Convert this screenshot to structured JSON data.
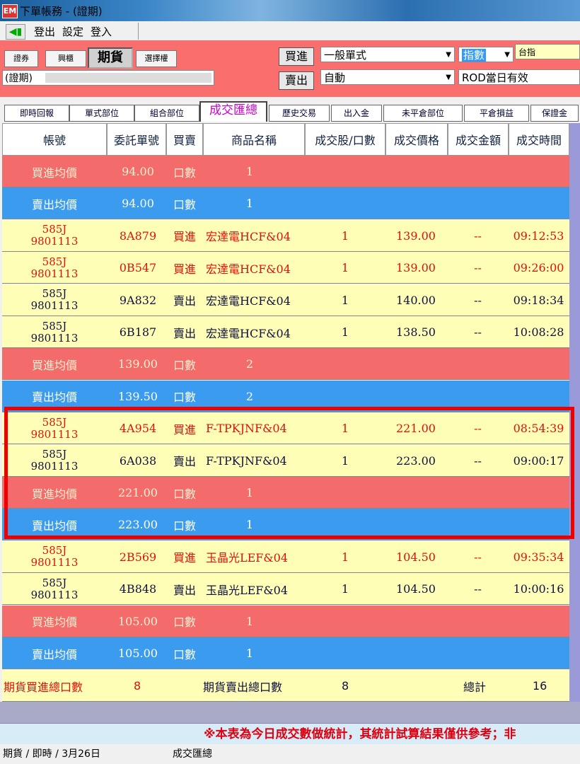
{
  "window": {
    "title": "下單帳務 - (證期)",
    "app_badge": "EM"
  },
  "menu": {
    "items": [
      "登出",
      "設定",
      "登入"
    ]
  },
  "toolbar": {
    "market_buttons": [
      "證券",
      "興櫃",
      "期貨",
      "選擇權"
    ],
    "account": "(證期)",
    "buy_label": "買進",
    "sell_label": "賣出",
    "order_type": "一般單式",
    "auto": "自動",
    "index_type": "指數",
    "index_name": "台指",
    "validity": "ROD當日有效"
  },
  "tabs": [
    "即時回報",
    "單式部位",
    "組合部位",
    "成交匯總",
    "歷史交易",
    "出入金",
    "未平倉部位",
    "平倉損益",
    "保證金"
  ],
  "columns": [
    "帳號",
    "委託單號",
    "買賣",
    "商品名稱",
    "成交股/口數",
    "成交價格",
    "成交金額",
    "成交時間"
  ],
  "rows": [
    {
      "kind": "buy-avg",
      "label": "買進均價",
      "price": "94.00",
      "unit": "口數",
      "count": "1"
    },
    {
      "kind": "sell-avg",
      "label": "賣出均價",
      "price": "94.00",
      "unit": "口數",
      "count": "1"
    },
    {
      "kind": "trade",
      "color": "red",
      "acct1": "585J",
      "acct2": "9801113",
      "order": "8A879",
      "side": "買進",
      "product": "宏達電HCF&04",
      "qty": "1",
      "price": "139.00",
      "amount": "--",
      "time": "09:12:53"
    },
    {
      "kind": "trade",
      "color": "red",
      "acct1": "585J",
      "acct2": "9801113",
      "order": "0B547",
      "side": "買進",
      "product": "宏達電HCF&04",
      "qty": "1",
      "price": "139.00",
      "amount": "--",
      "time": "09:26:00"
    },
    {
      "kind": "trade",
      "color": "blk",
      "acct1": "585J",
      "acct2": "9801113",
      "order": "9A832",
      "side": "賣出",
      "product": "宏達電HCF&04",
      "qty": "1",
      "price": "140.00",
      "amount": "--",
      "time": "09:18:34"
    },
    {
      "kind": "trade",
      "color": "blk",
      "acct1": "585J",
      "acct2": "9801113",
      "order": "6B187",
      "side": "賣出",
      "product": "宏達電HCF&04",
      "qty": "1",
      "price": "138.50",
      "amount": "--",
      "time": "10:08:28"
    },
    {
      "kind": "buy-avg",
      "label": "買進均價",
      "price": "139.00",
      "unit": "口數",
      "count": "2"
    },
    {
      "kind": "sell-avg",
      "label": "賣出均價",
      "price": "139.50",
      "unit": "口數",
      "count": "2"
    },
    {
      "kind": "trade",
      "color": "red",
      "acct1": "585J",
      "acct2": "9801113",
      "order": "4A954",
      "side": "買進",
      "product": "F-TPKJNF&04",
      "qty": "1",
      "price": "221.00",
      "amount": "--",
      "time": "08:54:39"
    },
    {
      "kind": "trade",
      "color": "blk",
      "acct1": "585J",
      "acct2": "9801113",
      "order": "6A038",
      "side": "賣出",
      "product": "F-TPKJNF&04",
      "qty": "1",
      "price": "223.00",
      "amount": "--",
      "time": "09:00:17"
    },
    {
      "kind": "buy-avg",
      "label": "買進均價",
      "price": "221.00",
      "unit": "口數",
      "count": "1"
    },
    {
      "kind": "sell-avg",
      "label": "賣出均價",
      "price": "223.00",
      "unit": "口數",
      "count": "1"
    },
    {
      "kind": "trade",
      "color": "red",
      "acct1": "585J",
      "acct2": "9801113",
      "order": "2B569",
      "side": "買進",
      "product": "玉晶光LEF&04",
      "qty": "1",
      "price": "104.50",
      "amount": "--",
      "time": "09:35:34"
    },
    {
      "kind": "trade",
      "color": "blk",
      "acct1": "585J",
      "acct2": "9801113",
      "order": "4B848",
      "side": "賣出",
      "product": "玉晶光LEF&04",
      "qty": "1",
      "price": "104.50",
      "amount": "--",
      "time": "10:00:16"
    },
    {
      "kind": "buy-avg",
      "label": "買進均價",
      "price": "105.00",
      "unit": "口數",
      "count": "1"
    },
    {
      "kind": "sell-avg",
      "label": "賣出均價",
      "price": "105.00",
      "unit": "口數",
      "count": "1"
    }
  ],
  "totals": {
    "buy_label": "期貨買進總口數",
    "buy_value": "8",
    "sell_label": "期貨賣出總口數",
    "sell_value": "8",
    "total_label": "總計",
    "total_value": "16"
  },
  "notice": "※本表為今日成交數做統計，其統計試算結果僅供參考；非",
  "status": {
    "left": "期貨 / 即時 /  3月26日",
    "right": "成交匯總"
  },
  "colors": {
    "buy_row": "#f36b6b",
    "sell_row": "#3a9bef",
    "trade_row": "#fefeb6",
    "toolbar": "#fb6e6e",
    "highlight": "#ee0000"
  }
}
